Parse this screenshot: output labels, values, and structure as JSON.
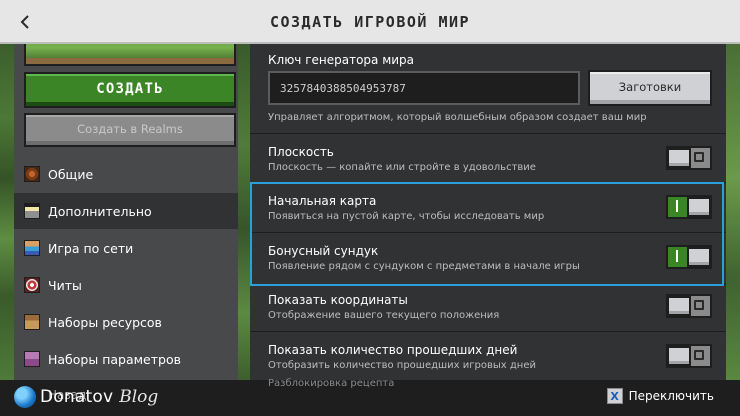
{
  "header": {
    "title": "СОЗДАТЬ ИГРОВОЙ МИР",
    "back_icon": "chevron-left-icon"
  },
  "sidebar": {
    "create_label": "СОЗДАТЬ",
    "realms_label": "Создать в Realms",
    "items": [
      {
        "label": "Общие",
        "icon": "command-block-icon",
        "selected": false
      },
      {
        "label": "Дополнительно",
        "icon": "advanced-icon",
        "selected": true
      },
      {
        "label": "Игра по сети",
        "icon": "multiplayer-icon",
        "selected": false
      },
      {
        "label": "Читы",
        "icon": "cheats-icon",
        "selected": false
      },
      {
        "label": "Наборы ресурсов",
        "icon": "resource-pack-icon",
        "selected": false
      },
      {
        "label": "Наборы параметров",
        "icon": "behavior-pack-icon",
        "selected": false
      }
    ]
  },
  "settings": {
    "seed": {
      "label": "Ключ генератора мира",
      "value": "3257840388504953787",
      "presets_label": "Заготовки",
      "description": "Управляет алгоритмом, который волшебным образом создает ваш мир"
    },
    "toggles": [
      {
        "label": "Плоскость",
        "description": "Плоскость — копайте или стройте в удовольствие",
        "on": false
      },
      {
        "label": "Начальная карта",
        "description": "Появиться на пустой карте, чтобы исследовать мир",
        "on": true
      },
      {
        "label": "Бонусный сундук",
        "description": "Появление рядом с сундуком с предметами в начале игры",
        "on": true
      },
      {
        "label": "Показать координаты",
        "description": "Отображение вашего текущего положения",
        "on": false
      },
      {
        "label": "Показать количество прошедших дней",
        "description": "Отобразить количество прошедших игровых дней",
        "on": false
      }
    ],
    "overflow_label": "Разблокировка рецепта"
  },
  "footer": {
    "back_label": "Назад",
    "switch_key": "X",
    "switch_label": "Переключить"
  },
  "watermark": {
    "brand": "Donatov",
    "suffix": "Blog"
  },
  "colors": {
    "accent_green": "#3c8527",
    "highlight_blue": "#2b9fdc",
    "panel_dark": "#313233",
    "panel_sidebar": "#48494a",
    "header_bg": "#e6e6e6"
  }
}
